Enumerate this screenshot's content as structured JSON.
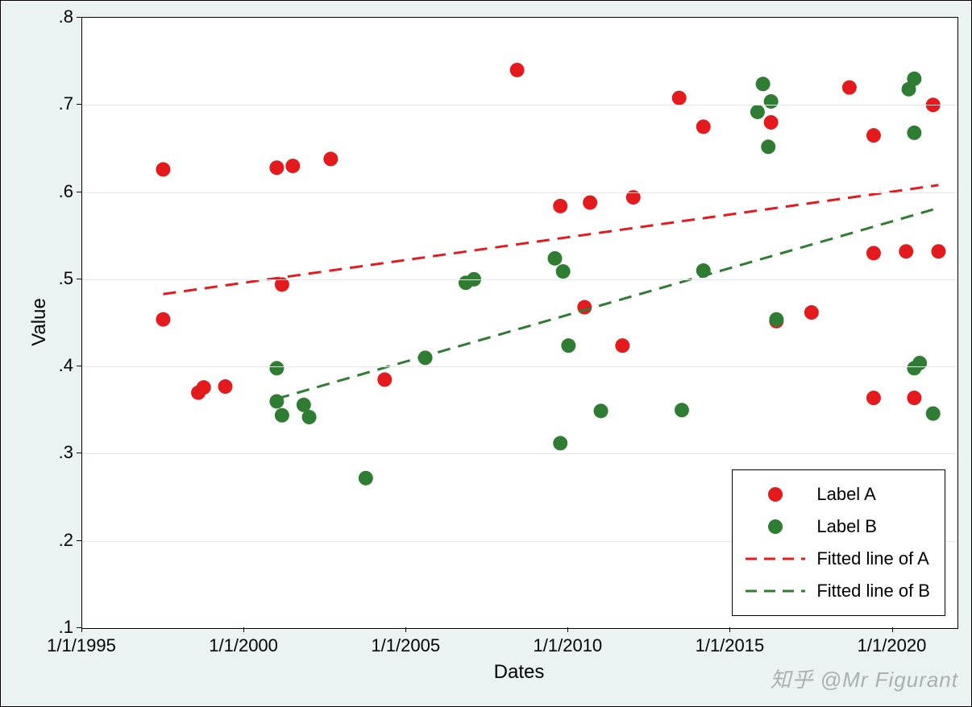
{
  "chart_data": {
    "type": "scatter",
    "xlabel": "Dates",
    "ylabel": "Value",
    "xlim_dates": [
      "1995-01-01",
      "2022-01-01"
    ],
    "ylim": [
      0.1,
      0.8
    ],
    "x_ticks": [
      "1/1/1995",
      "1/1/2000",
      "1/1/2005",
      "1/1/2010",
      "1/1/2015",
      "1/1/2020"
    ],
    "y_ticks": [
      0.1,
      0.2,
      0.3,
      0.4,
      0.5,
      0.6,
      0.7,
      0.8
    ],
    "grid": {
      "y": true,
      "x": false
    },
    "series": [
      {
        "name": "Label A",
        "type": "scatter",
        "color": "#e41a1c",
        "points": [
          {
            "date": "1997-07-01",
            "y": 0.626
          },
          {
            "date": "1997-07-01",
            "y": 0.454
          },
          {
            "date": "1998-08-01",
            "y": 0.37
          },
          {
            "date": "1998-10-01",
            "y": 0.376
          },
          {
            "date": "1999-06-01",
            "y": 0.377
          },
          {
            "date": "2001-01-01",
            "y": 0.628
          },
          {
            "date": "2001-03-01",
            "y": 0.494
          },
          {
            "date": "2001-07-01",
            "y": 0.63
          },
          {
            "date": "2002-09-01",
            "y": 0.638
          },
          {
            "date": "2004-05-01",
            "y": 0.385
          },
          {
            "date": "2008-06-01",
            "y": 0.74
          },
          {
            "date": "2009-10-01",
            "y": 0.584
          },
          {
            "date": "2010-07-01",
            "y": 0.468
          },
          {
            "date": "2010-09-01",
            "y": 0.588
          },
          {
            "date": "2011-09-01",
            "y": 0.424
          },
          {
            "date": "2012-01-01",
            "y": 0.594
          },
          {
            "date": "2013-06-01",
            "y": 0.708
          },
          {
            "date": "2014-03-01",
            "y": 0.675
          },
          {
            "date": "2016-04-01",
            "y": 0.68
          },
          {
            "date": "2016-06-01",
            "y": 0.452
          },
          {
            "date": "2017-07-01",
            "y": 0.462
          },
          {
            "date": "2018-09-01",
            "y": 0.72
          },
          {
            "date": "2019-06-01",
            "y": 0.53
          },
          {
            "date": "2019-06-01",
            "y": 0.665
          },
          {
            "date": "2019-06-01",
            "y": 0.364
          },
          {
            "date": "2020-06-01",
            "y": 0.532
          },
          {
            "date": "2020-09-01",
            "y": 0.364
          },
          {
            "date": "2021-04-01",
            "y": 0.7
          },
          {
            "date": "2021-06-01",
            "y": 0.532
          }
        ]
      },
      {
        "name": "Label B",
        "type": "scatter",
        "color": "#2e7d32",
        "points": [
          {
            "date": "2001-01-01",
            "y": 0.398
          },
          {
            "date": "2001-01-01",
            "y": 0.36
          },
          {
            "date": "2001-03-01",
            "y": 0.344
          },
          {
            "date": "2001-11-01",
            "y": 0.356
          },
          {
            "date": "2002-01-01",
            "y": 0.342
          },
          {
            "date": "2003-10-01",
            "y": 0.272
          },
          {
            "date": "2005-08-01",
            "y": 0.41
          },
          {
            "date": "2006-11-01",
            "y": 0.496
          },
          {
            "date": "2007-02-01",
            "y": 0.5
          },
          {
            "date": "2009-08-01",
            "y": 0.524
          },
          {
            "date": "2009-10-01",
            "y": 0.312
          },
          {
            "date": "2009-11-01",
            "y": 0.509
          },
          {
            "date": "2010-01-01",
            "y": 0.424
          },
          {
            "date": "2011-01-01",
            "y": 0.349
          },
          {
            "date": "2013-07-01",
            "y": 0.35
          },
          {
            "date": "2014-03-01",
            "y": 0.51
          },
          {
            "date": "2015-11-01",
            "y": 0.692
          },
          {
            "date": "2016-01-01",
            "y": 0.724
          },
          {
            "date": "2016-03-01",
            "y": 0.652
          },
          {
            "date": "2016-04-01",
            "y": 0.704
          },
          {
            "date": "2016-06-01",
            "y": 0.454
          },
          {
            "date": "2020-07-01",
            "y": 0.718
          },
          {
            "date": "2020-09-01",
            "y": 0.73
          },
          {
            "date": "2020-09-01",
            "y": 0.398
          },
          {
            "date": "2020-09-01",
            "y": 0.668
          },
          {
            "date": "2020-11-01",
            "y": 0.404
          },
          {
            "date": "2021-04-01",
            "y": 0.346
          }
        ]
      },
      {
        "name": "Fitted line of A",
        "type": "line",
        "style": "dashed",
        "color": "#e41a1c",
        "p1": {
          "date": "1997-07-01",
          "y": 0.483
        },
        "p2": {
          "date": "2021-06-01",
          "y": 0.608
        }
      },
      {
        "name": "Fitted line of B",
        "type": "line",
        "style": "dashed",
        "color": "#2e7d32",
        "p1": {
          "date": "2001-01-01",
          "y": 0.363
        },
        "p2": {
          "date": "2021-04-01",
          "y": 0.58
        }
      }
    ],
    "legend": {
      "position": "bottom-right-inside",
      "items": [
        "Label A",
        "Label B",
        "Fitted line of A",
        "Fitted line of B"
      ]
    }
  },
  "watermark": "知乎 @Mr Figurant"
}
